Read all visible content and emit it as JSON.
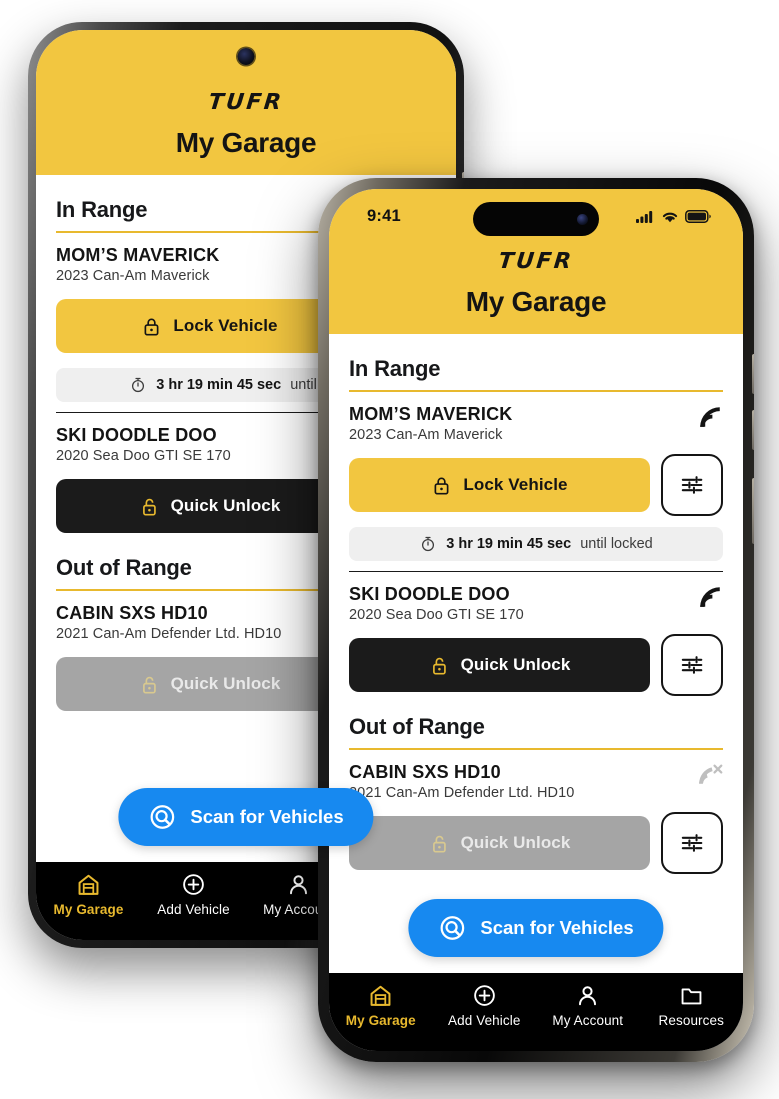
{
  "brand": "TUFR",
  "page_title": "My Garage",
  "status_bar": {
    "time": "9:41",
    "cellular_icon": "cellular-bars-icon",
    "wifi_icon": "wifi-icon",
    "battery_icon": "battery-full-icon"
  },
  "colors": {
    "brand_yellow": "#F2C640",
    "rule_yellow": "#E8B92E",
    "dark": "#1B1B1B",
    "disabled_gray": "#A5A5A5",
    "scan_blue": "#1789F0",
    "pill_gray": "#EFEFEF"
  },
  "sections": [
    {
      "title": "In Range",
      "vehicles": [
        {
          "name": "MOM’S MAVERICK",
          "subtitle": "2023 Can-Am Maverick",
          "signal_icon": "signal-in-range-icon",
          "signal_state": "in-range",
          "action_label": "Lock Vehicle",
          "action_style": "lock",
          "action_icon": "lock-closed-icon",
          "settings_icon": "sliders-icon",
          "timer": {
            "icon": "stopwatch-icon",
            "value": "3 hr 19 min 45 sec",
            "suffix": "until locked"
          }
        },
        {
          "name": "SKI DOODLE DOO",
          "subtitle": "2020 Sea Doo GTI SE 170",
          "signal_icon": "signal-in-range-icon",
          "signal_state": "in-range",
          "action_label": "Quick Unlock",
          "action_style": "unlock",
          "action_icon": "lock-open-icon",
          "settings_icon": "sliders-icon",
          "timer": null
        }
      ]
    },
    {
      "title": "Out of Range",
      "vehicles": [
        {
          "name": "CABIN SXS HD10",
          "subtitle": "2021 Can-Am Defender Ltd. HD10",
          "signal_icon": "signal-out-of-range-icon",
          "signal_state": "out-of-range",
          "action_label": "Quick Unlock",
          "action_style": "disabled",
          "action_icon": "lock-open-icon",
          "settings_icon": "sliders-icon",
          "timer": null
        }
      ]
    }
  ],
  "scan_button": {
    "label": "Scan for Vehicles",
    "icon": "scan-target-icon"
  },
  "tabs": [
    {
      "label": "My Garage",
      "icon": "garage-icon",
      "active": true
    },
    {
      "label": "Add Vehicle",
      "icon": "plus-circle-icon",
      "active": false
    },
    {
      "label": "My Account",
      "icon": "person-icon",
      "active": false
    },
    {
      "label": "Resources",
      "icon": "folder-icon",
      "active": false
    }
  ]
}
